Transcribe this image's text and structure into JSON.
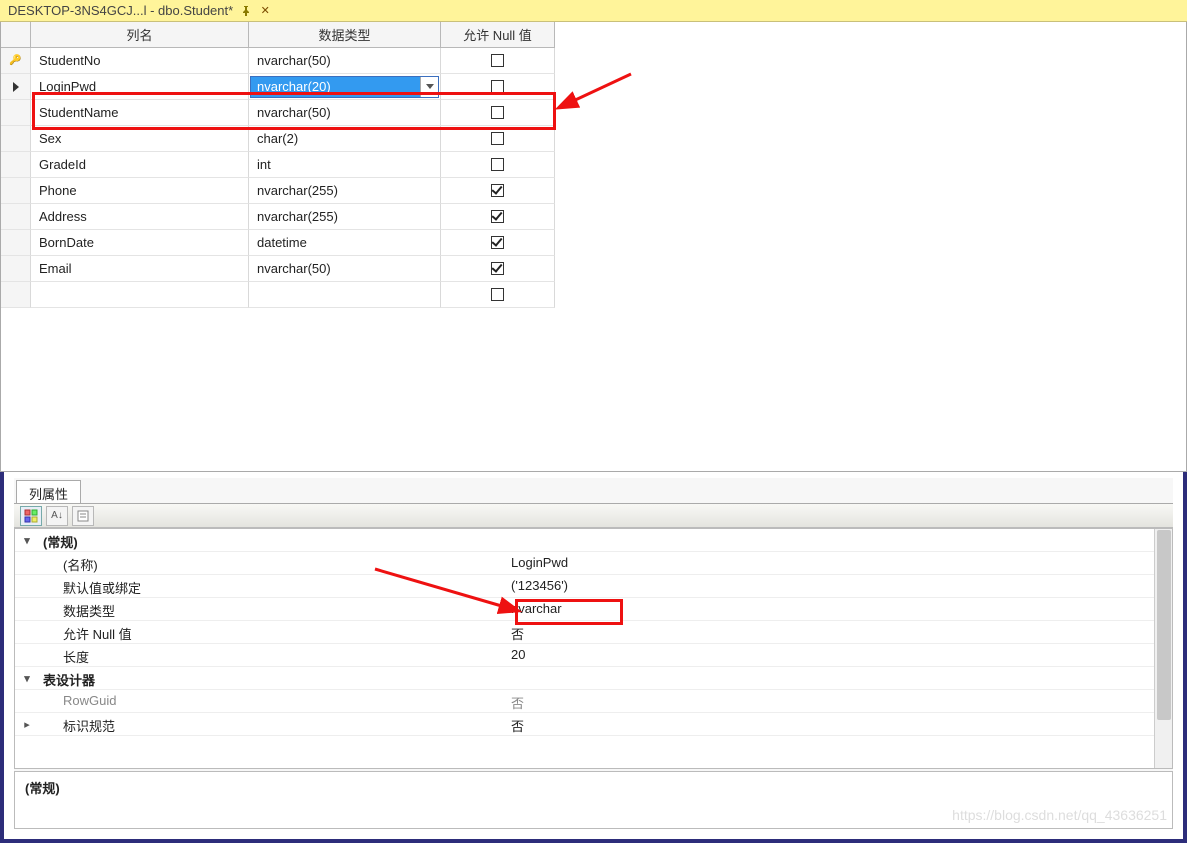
{
  "tab": {
    "title": "DESKTOP-3NS4GCJ...l - dbo.Student*"
  },
  "grid": {
    "headers": {
      "name": "列名",
      "type": "数据类型",
      "null": "允许 Null 值"
    },
    "rows": [
      {
        "icon": "key",
        "name": "StudentNo",
        "type": "nvarchar(50)",
        "null": false
      },
      {
        "icon": "arrow",
        "name": "LoginPwd",
        "type": "nvarchar(20)",
        "null": false,
        "editing": true
      },
      {
        "name": "StudentName",
        "type": "nvarchar(50)",
        "null": false
      },
      {
        "name": "Sex",
        "type": "char(2)",
        "null": false
      },
      {
        "name": "GradeId",
        "type": "int",
        "null": false
      },
      {
        "name": "Phone",
        "type": "nvarchar(255)",
        "null": true
      },
      {
        "name": "Address",
        "type": "nvarchar(255)",
        "null": true
      },
      {
        "name": "BornDate",
        "type": "datetime",
        "null": true
      },
      {
        "name": "Email",
        "type": "nvarchar(50)",
        "null": true
      },
      {
        "name": "",
        "type": "",
        "null": false,
        "blank": true
      }
    ]
  },
  "props": {
    "tab": "列属性",
    "cat1": "(常规)",
    "rows": [
      {
        "label": "(名称)",
        "value": "LoginPwd"
      },
      {
        "label": "默认值或绑定",
        "value": "('123456')",
        "highlight": true
      },
      {
        "label": "数据类型",
        "value": "nvarchar"
      },
      {
        "label": "允许 Null 值",
        "value": "否"
      },
      {
        "label": "长度",
        "value": "20"
      }
    ],
    "cat2": "表设计器",
    "rows2": [
      {
        "label": "RowGuid",
        "value": "否",
        "dim": true
      },
      {
        "label": "标识规范",
        "value": "否",
        "expand": true
      }
    ],
    "desc_title": "(常规)"
  },
  "watermark": "https://blog.csdn.net/qq_43636251"
}
